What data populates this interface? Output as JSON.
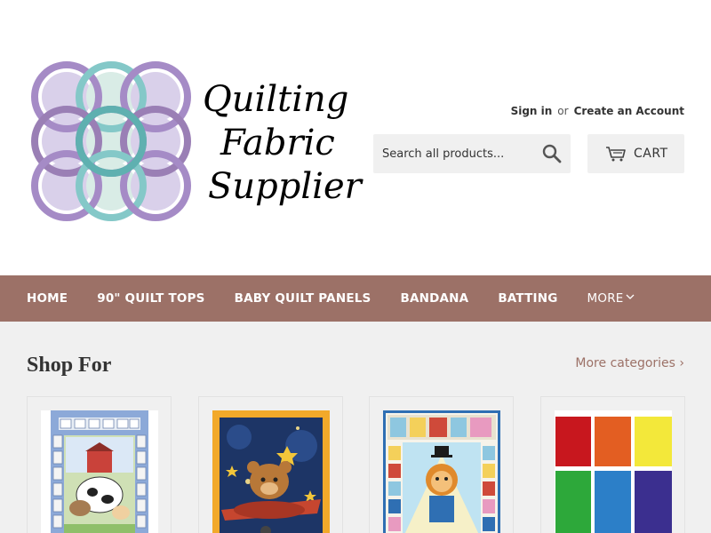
{
  "brand": {
    "name_lines": [
      "Quilting",
      "Fabric",
      "Supplier"
    ],
    "logo_colors": {
      "purple": "#a58bc6",
      "teal": "#84c8c8",
      "fill_purple": "#d9d0ea",
      "fill_teal": "#d9ece6"
    }
  },
  "account": {
    "sign_in": "Sign in",
    "or": "or",
    "create_account": "Create an Account"
  },
  "search": {
    "placeholder": "Search all products...",
    "icon": "search-icon"
  },
  "cart": {
    "label": "CART",
    "icon": "cart-icon"
  },
  "nav": {
    "background": "#9c7167",
    "items": [
      {
        "label": "HOME"
      },
      {
        "label": "90\" QUILT TOPS"
      },
      {
        "label": "BABY QUILT PANELS"
      },
      {
        "label": "BANDANA"
      },
      {
        "label": "BATTING"
      }
    ],
    "more": {
      "label": "MORE",
      "icon": "chevron-down-icon"
    }
  },
  "section": {
    "title": "Shop For",
    "more_link": "More categories ›"
  },
  "categories": [
    {
      "image": "farm-animals-baby-panel"
    },
    {
      "image": "teddy-bear-airplane-panel"
    },
    {
      "image": "circus-lion-panel"
    },
    {
      "image": "solid-color-swatches"
    }
  ],
  "colors": {
    "accent": "#9c7167",
    "page_bg": "#f0f0f0",
    "text": "#333333"
  }
}
